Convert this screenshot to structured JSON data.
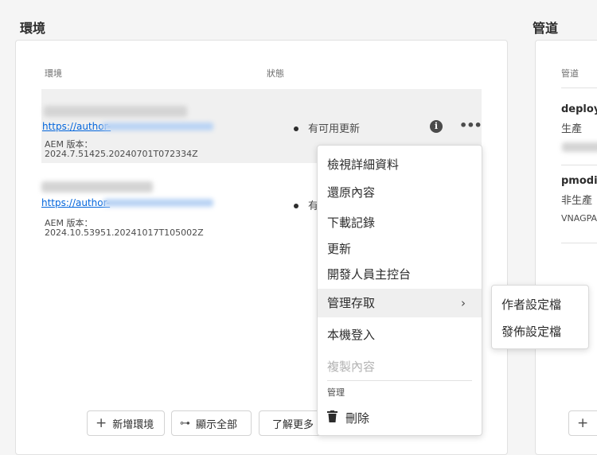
{
  "environments_section": {
    "title": "環境",
    "columns": {
      "environment": "環境",
      "status": "狀態"
    },
    "rows": [
      {
        "url": "https://author-",
        "aem_label": "AEM 版本：",
        "version": "2024.7.51425.20240701T072334Z",
        "status": "有可用更新"
      },
      {
        "url": "https://author-",
        "aem_label": "AEM 版本：",
        "version": "2024.10.53951.20241017T105002Z",
        "status": "有"
      }
    ],
    "buttons": {
      "add": "新增環境",
      "show_all": "顯示全部",
      "learn_more": "了解更多"
    }
  },
  "context_menu": {
    "items": [
      {
        "label": "檢視詳細資料"
      },
      {
        "label": "還原內容"
      },
      {
        "label": "下載記錄"
      },
      {
        "label": "更新"
      },
      {
        "label": "開發人員主控台"
      },
      {
        "label": "管理存取"
      },
      {
        "label": "本機登入"
      },
      {
        "label": "複製內容"
      }
    ],
    "section_label": "管理",
    "delete_label": "刪除"
  },
  "submenu": {
    "items": [
      {
        "label": "作者設定檔"
      },
      {
        "label": "發佈設定檔"
      }
    ]
  },
  "pipelines_section": {
    "title": "管道",
    "column": "管道",
    "rows": [
      {
        "name": "deploy",
        "type": "生產"
      },
      {
        "name": "pmodi-",
        "type": "非生產",
        "extra": "VNAGPA"
      }
    ]
  },
  "colors": {
    "link": "#0265dc",
    "highlight_row": "#f0f0f0",
    "disabled_text": "#b3b3b3"
  }
}
